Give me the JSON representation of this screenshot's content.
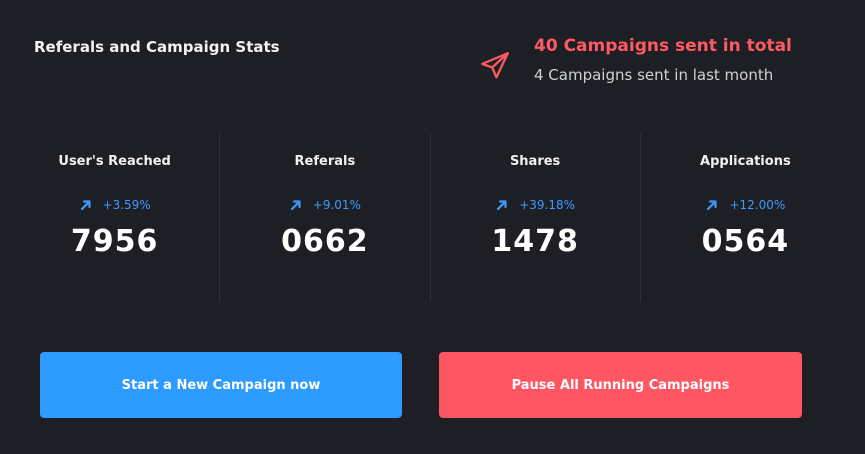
{
  "header": {
    "title": "Referals and Campaign Stats"
  },
  "summary": {
    "icon": "paper-plane-icon",
    "total_text": "40 Campaigns sent in total",
    "month_text": "4 Campaigns sent in last month",
    "accent_color": "#ff5a63"
  },
  "stats": [
    {
      "label": "User's Reached",
      "change": "+3.59%",
      "value": "7956",
      "trend_icon": "arrow-up-right-icon"
    },
    {
      "label": "Referals",
      "change": "+9.01%",
      "value": "0662",
      "trend_icon": "arrow-up-right-icon"
    },
    {
      "label": "Shares",
      "change": "+39.18%",
      "value": "1478",
      "trend_icon": "arrow-up-right-icon"
    },
    {
      "label": "Applications",
      "change": "+12.00%",
      "value": "0564",
      "trend_icon": "arrow-up-right-icon"
    }
  ],
  "actions": {
    "start_label": "Start a New Campaign now",
    "pause_label": "Pause All Running Campaigns",
    "start_color": "#2d9bff",
    "pause_color": "#ff5663"
  },
  "colors": {
    "background": "#1e1f24",
    "positive_change": "#3b9bff"
  }
}
